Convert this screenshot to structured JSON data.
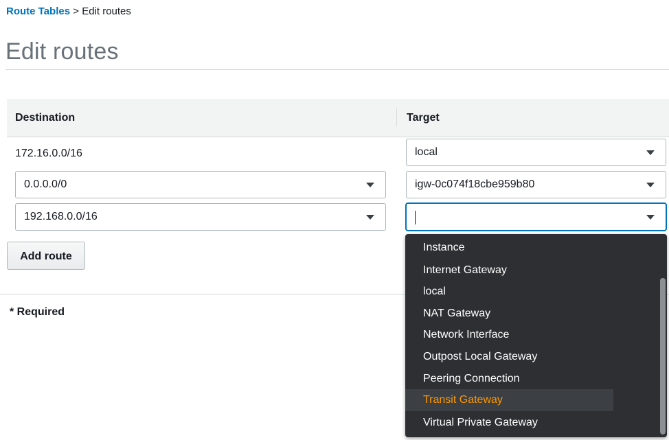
{
  "breadcrumb": {
    "link": "Route Tables",
    "separator": " > ",
    "current": "Edit routes"
  },
  "page": {
    "title": "Edit routes"
  },
  "table": {
    "headers": {
      "destination": "Destination",
      "target": "Target"
    },
    "rows": [
      {
        "destination": "172.16.0.0/16",
        "target": "local"
      },
      {
        "destination": "0.0.0.0/0",
        "target": "igw-0c074f18cbe959b80"
      },
      {
        "destination": "192.168.0.0/16",
        "target": ""
      }
    ]
  },
  "actions": {
    "add_route": "Add route"
  },
  "footer": {
    "required_note": "* Required"
  },
  "dropdown": {
    "options": [
      "Instance",
      "Internet Gateway",
      "local",
      "NAT Gateway",
      "Network Interface",
      "Outpost Local Gateway",
      "Peering Connection",
      "Transit Gateway",
      "Virtual Private Gateway"
    ],
    "highlighted": "Transit Gateway"
  },
  "colors": {
    "link": "#0073bb",
    "highlight_text": "#ff9900",
    "dropdown_bg": "#2d2f33"
  },
  "icons": {
    "select_caret": "caret-down-icon"
  }
}
